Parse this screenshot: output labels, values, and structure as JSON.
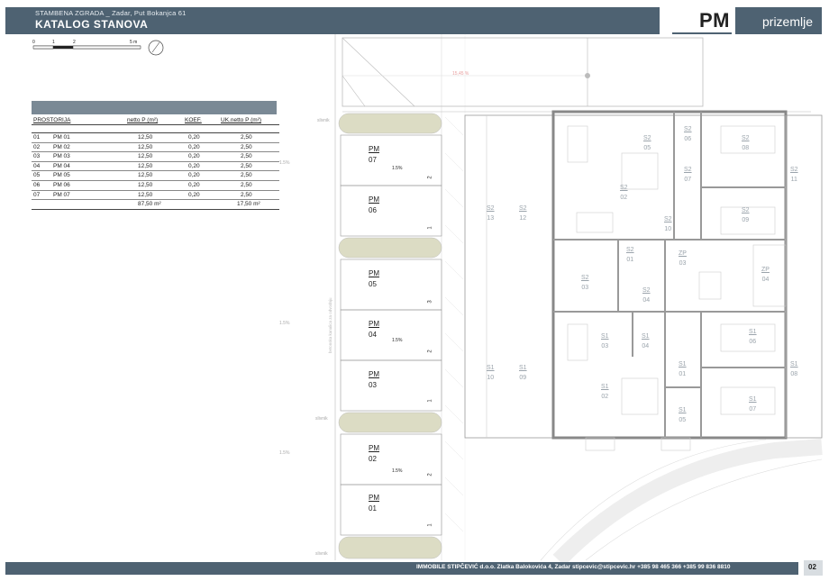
{
  "header": {
    "subtitle": "STAMBENA ZGRADA _ Zadar, Put Bokanjca 61",
    "title": "KATALOG STANOVA",
    "code": "PM",
    "floor": "prizemlje"
  },
  "scale": {
    "labels": [
      "0",
      "1",
      "2",
      "5 m"
    ]
  },
  "table": {
    "headers": [
      "PROSTORIJA",
      "netto P (m²)",
      "KOEF.",
      "UK.netto P (m²)"
    ],
    "rows": [
      {
        "no": "01",
        "name": "PM 01",
        "area": "12,50",
        "coef": "0,20",
        "total": "2,50"
      },
      {
        "no": "02",
        "name": "PM 02",
        "area": "12,50",
        "coef": "0,20",
        "total": "2,50"
      },
      {
        "no": "03",
        "name": "PM 03",
        "area": "12,50",
        "coef": "0,20",
        "total": "2,50"
      },
      {
        "no": "04",
        "name": "PM 04",
        "area": "12,50",
        "coef": "0,20",
        "total": "2,50"
      },
      {
        "no": "05",
        "name": "PM 05",
        "area": "12,50",
        "coef": "0,20",
        "total": "2,50"
      },
      {
        "no": "06",
        "name": "PM 06",
        "area": "12,50",
        "coef": "0,20",
        "total": "2,50"
      },
      {
        "no": "07",
        "name": "PM 07",
        "area": "12,50",
        "coef": "0,20",
        "total": "2,50"
      }
    ],
    "sum_area": "87,50 m²",
    "sum_total": "17,50 m²"
  },
  "parking": [
    {
      "code": "PM",
      "num": "07",
      "slope": "1.5%",
      "side": "2"
    },
    {
      "code": "PM",
      "num": "06",
      "slope": "",
      "side": "1"
    },
    {
      "code": "PM",
      "num": "05",
      "slope": "",
      "side": "3"
    },
    {
      "code": "PM",
      "num": "04",
      "slope": "1.5%",
      "side": "2"
    },
    {
      "code": "PM",
      "num": "03",
      "slope": "",
      "side": "1"
    },
    {
      "code": "PM",
      "num": "02",
      "slope": "1.5%",
      "side": "2"
    },
    {
      "code": "PM",
      "num": "01",
      "slope": "",
      "side": "1"
    }
  ],
  "ramp_label": "15,45 %",
  "side_slopes": [
    "1.5%",
    "1.5%",
    "1.5%"
  ],
  "slivnik": "slivnik",
  "canal_label": "betonska kanalica za odvodnju",
  "rooms": [
    {
      "code": "S2",
      "num": "05"
    },
    {
      "code": "S2",
      "num": "06"
    },
    {
      "code": "S2",
      "num": "08"
    },
    {
      "code": "S2",
      "num": "07"
    },
    {
      "code": "S2",
      "num": "11"
    },
    {
      "code": "S2",
      "num": "02"
    },
    {
      "code": "S2",
      "num": "13"
    },
    {
      "code": "S2",
      "num": "12"
    },
    {
      "code": "S2",
      "num": "10"
    },
    {
      "code": "S2",
      "num": "09"
    },
    {
      "code": "S2",
      "num": "01"
    },
    {
      "code": "ZP",
      "num": "03"
    },
    {
      "code": "ZP",
      "num": "04"
    },
    {
      "code": "S2",
      "num": "03"
    },
    {
      "code": "S2",
      "num": "04"
    },
    {
      "code": "S1",
      "num": "03"
    },
    {
      "code": "S1",
      "num": "04"
    },
    {
      "code": "S1",
      "num": "06"
    },
    {
      "code": "S1",
      "num": "10"
    },
    {
      "code": "S1",
      "num": "09"
    },
    {
      "code": "S1",
      "num": "01"
    },
    {
      "code": "S1",
      "num": "08"
    },
    {
      "code": "S1",
      "num": "02"
    },
    {
      "code": "S1",
      "num": "05"
    },
    {
      "code": "S1",
      "num": "07"
    }
  ],
  "footer": {
    "text": "IMMOBILE STIPČEVIĆ d.o.o.   Zlatka Balokovića 4, Zadar    stipcevic@stipcevic.hr    +385 98 465 366    +385 99 836 8810",
    "page": "02"
  }
}
